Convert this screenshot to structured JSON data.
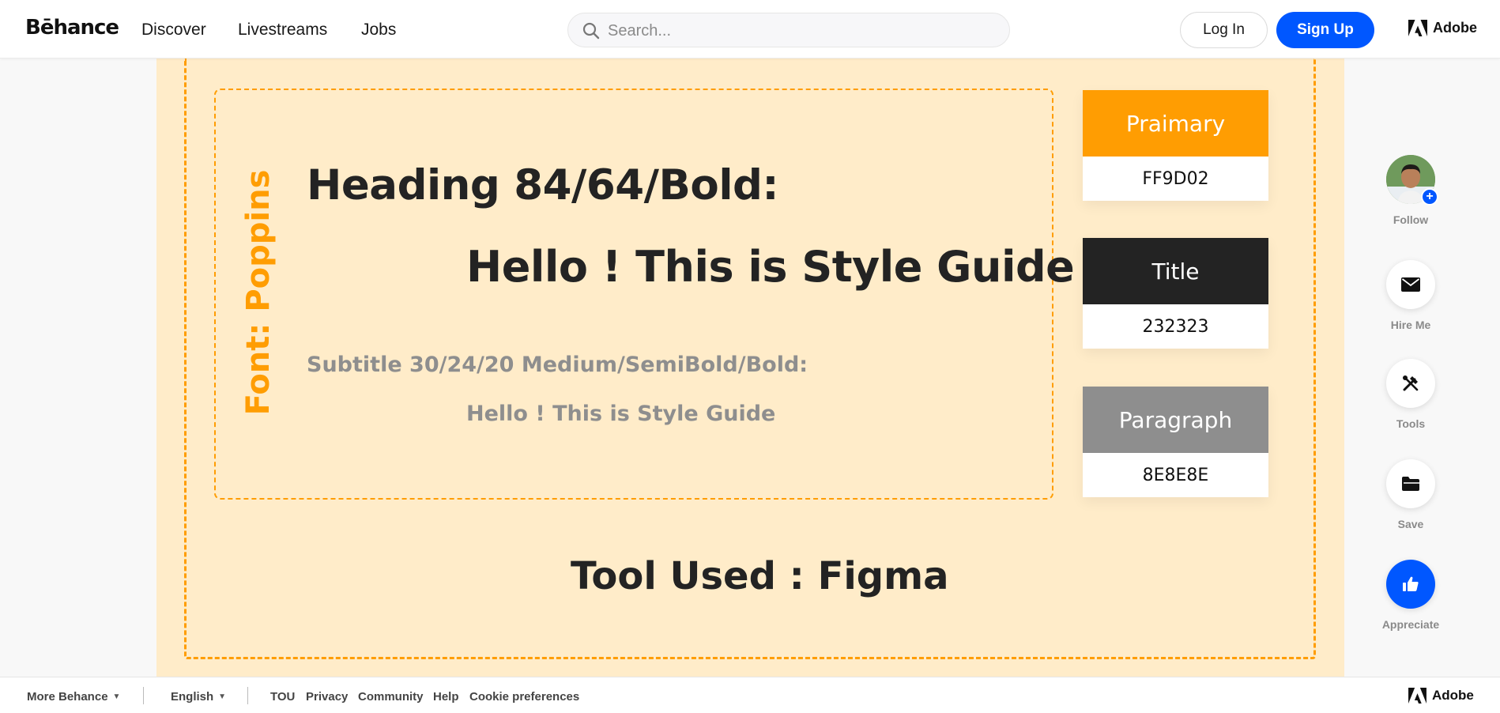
{
  "header": {
    "logo": "Bēhance",
    "nav": [
      "Discover",
      "Livestreams",
      "Jobs"
    ],
    "search_placeholder": "Search...",
    "login_label": "Log In",
    "signup_label": "Sign Up",
    "adobe_label": "Adobe"
  },
  "artwork": {
    "font_label": "Font:  Poppins",
    "heading_spec": "Heading 84/64/Bold:",
    "heading_sample": "Hello ! This is Style Guide",
    "subtitle_spec": "Subtitle 30/24/20 Medium/SemiBold/Bold:",
    "subtitle_sample": "Hello ! This is Style Guide",
    "tool_used": "Tool Used : Figma",
    "swatches": [
      {
        "name": "Praimary",
        "hex": "FF9D02",
        "color": "#ff9d02"
      },
      {
        "name": "Title",
        "hex": "232323",
        "color": "#232323"
      },
      {
        "name": "Paragraph",
        "hex": "8E8E8E",
        "color": "#8e8e8e"
      }
    ]
  },
  "rail": {
    "follow_label": "Follow",
    "hire_label": "Hire Me",
    "tools_label": "Tools",
    "save_label": "Save",
    "appreciate_label": "Appreciate"
  },
  "footer": {
    "more_behance": "More Behance",
    "language": "English",
    "links": [
      "TOU",
      "Privacy",
      "Community",
      "Help",
      "Cookie preferences"
    ],
    "adobe_label": "Adobe"
  },
  "colors": {
    "brand_blue": "#0057ff",
    "accent_orange": "#ff9d02",
    "canvas_bg": "#ffecc9"
  }
}
